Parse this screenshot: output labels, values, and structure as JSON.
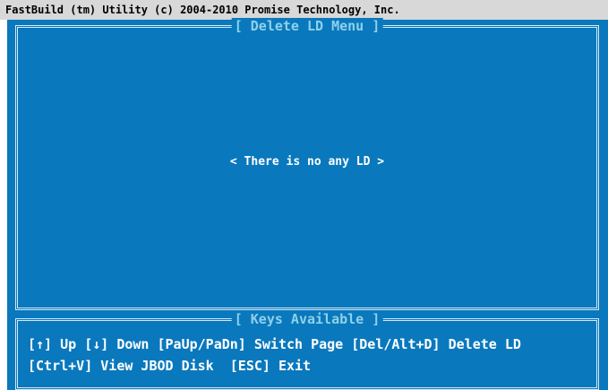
{
  "window": {
    "title": "FastBuild (tm) Utility (c) 2004-2010 Promise Technology, Inc."
  },
  "main_panel": {
    "title": "[ Delete LD Menu ]",
    "message": "< There is no any LD >"
  },
  "keys_panel": {
    "title": "[ Keys Available ]",
    "line1": "[↑] Up [↓] Down [PaUp/PaDn] Switch Page [Del/Alt+D] Delete LD",
    "line2": "[Ctrl+V] View JBOD Disk  [ESC] Exit"
  },
  "colors": {
    "background": "#0a78bd",
    "frame": "#d6e9f6",
    "title_text": "#8fd1e8",
    "body_text": "#ffffff",
    "titlebar": "#d8d8d8"
  }
}
